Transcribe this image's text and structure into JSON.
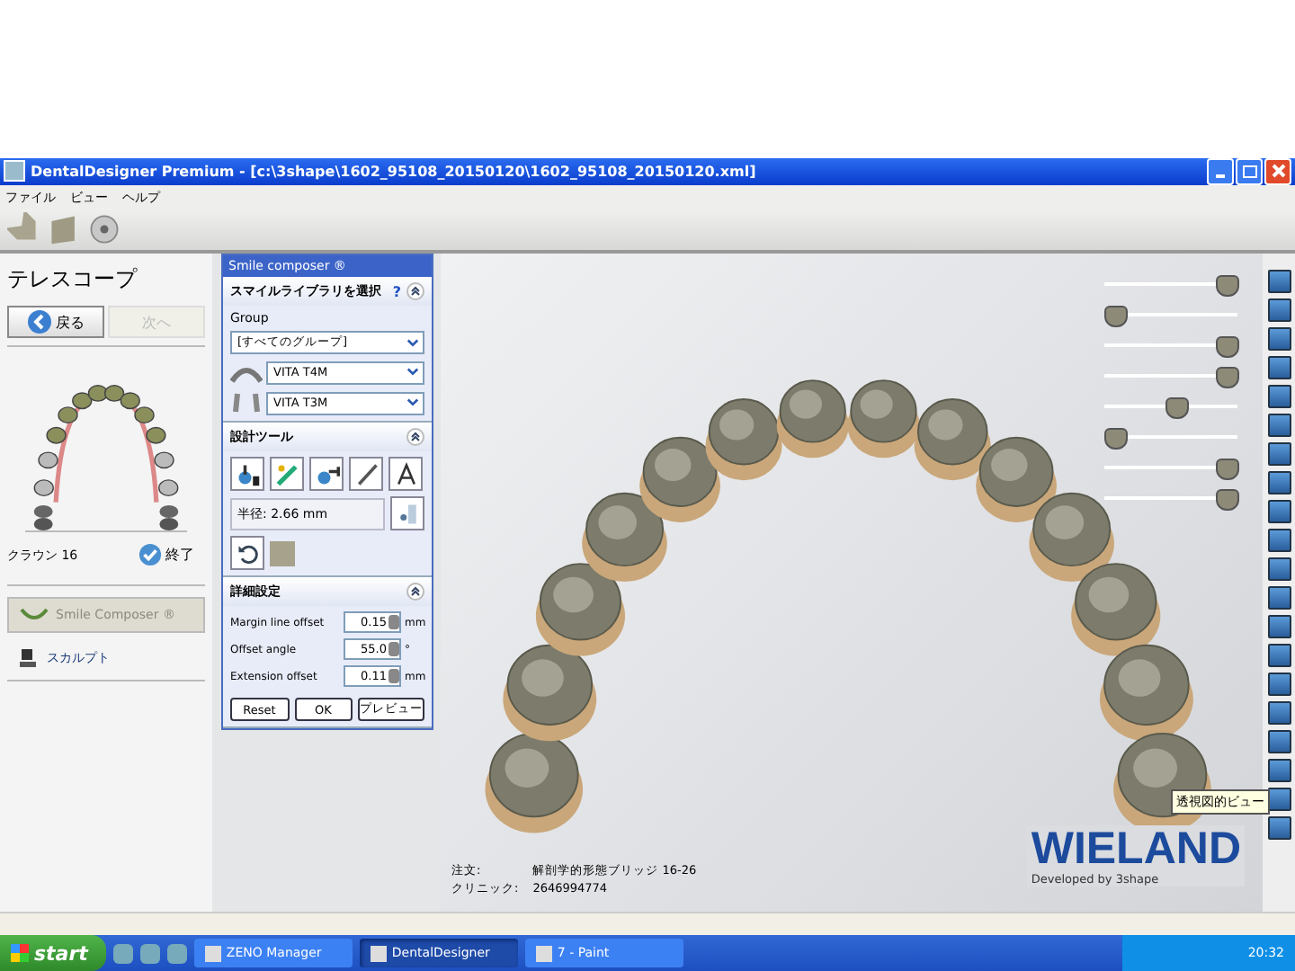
{
  "window": {
    "title": "DentalDesigner Premium - [c:\\3shape\\1602_95108_20150120\\1602_95108_20150120.xml]"
  },
  "menu": [
    "ファイル",
    "ビュー",
    "ヘルプ"
  ],
  "left_panel": {
    "title": "テレスコープ",
    "back": {
      "label": "戻る",
      "disabled": false
    },
    "next": {
      "label": "次へ",
      "disabled": true
    },
    "crown": "クラウン 16",
    "finish": "終了",
    "smile_composer": {
      "label": "Smile Composer ®",
      "disabled": true
    },
    "sculpt": "スカルプト"
  },
  "composer": {
    "title": "Smile composer ®",
    "library": {
      "title": "スマイルライブラリを選択",
      "help": "?",
      "group_label": "Group",
      "group": "[すべてのグループ]",
      "upper": "VITA T4M",
      "lower": "VITA T3M"
    },
    "tools": {
      "title": "設計ツール",
      "radius": "半径: 2.66 mm"
    },
    "settings": {
      "title": "詳細設定",
      "fields": [
        {
          "label": "Margin line offset",
          "value": "0.15",
          "unit": "mm"
        },
        {
          "label": "Offset angle",
          "value": "55.0",
          "unit": "°"
        },
        {
          "label": "Extension offset",
          "value": "0.11",
          "unit": "mm"
        }
      ]
    },
    "buttons": [
      "Reset",
      "OK",
      "プレビュー"
    ]
  },
  "sliders": [
    {
      "level": 1
    },
    {
      "level": 0
    },
    {
      "level": 1
    },
    {
      "level": 1
    },
    {
      "level": 0.55
    },
    {
      "level": 0
    },
    {
      "level": 1
    },
    {
      "level": 1
    }
  ],
  "info": {
    "order_label": "注文:",
    "order": "解剖学的形態ブリッジ 16-26",
    "clinic_label": "クリニック:",
    "clinic": "2646994774"
  },
  "logo": {
    "name": "WIELAND",
    "sub": "Developed by 3shape"
  },
  "tooltip": "透視図的ビュー",
  "taskbar": {
    "start": "start",
    "tasks": [
      {
        "label": "ZENO Manager",
        "selected": false
      },
      {
        "label": "DentalDesigner",
        "selected": true
      },
      {
        "label": "7 - Paint",
        "selected": false
      }
    ],
    "clock": "20:32"
  }
}
